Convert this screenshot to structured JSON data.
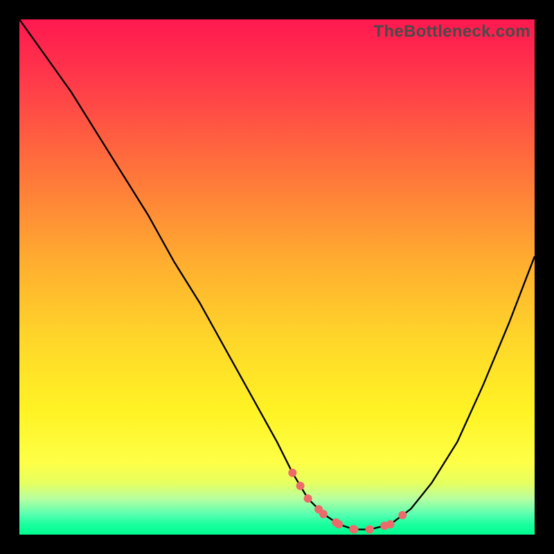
{
  "watermark": "TheBottleneck.com",
  "colors": {
    "frame": "#000000",
    "curve": "#000000",
    "marker": "#ec6a6a",
    "gradient_top": "#ff1850",
    "gradient_bottom": "#00ff8e"
  },
  "chart_data": {
    "type": "line",
    "title": "",
    "xlabel": "",
    "ylabel": "",
    "xlim": [
      0,
      100
    ],
    "ylim": [
      0,
      100
    ],
    "grid": false,
    "legend": false,
    "series": [
      {
        "name": "curve",
        "x": [
          0,
          5,
          10,
          15,
          20,
          25,
          30,
          35,
          40,
          45,
          50,
          53,
          56,
          59,
          62,
          65,
          68,
          72,
          76,
          80,
          85,
          90,
          95,
          100
        ],
        "y": [
          100,
          93,
          86,
          78,
          70,
          62,
          53,
          45,
          36,
          27,
          18,
          12,
          7,
          4,
          2,
          1,
          1,
          2,
          5,
          10,
          18,
          29,
          41,
          54
        ]
      }
    ],
    "markers": {
      "name": "highlight-region",
      "x": [
        53,
        56,
        59,
        62,
        65,
        68,
        72,
        76
      ],
      "y": [
        12,
        7,
        4,
        2,
        1,
        1,
        2,
        5
      ]
    },
    "note": "Axis values are relative (0-100) estimates read from an unlabeled gradient plot; curve shows bottleneck magnitude vs. an implicit x parameter with minimum near x≈65."
  }
}
